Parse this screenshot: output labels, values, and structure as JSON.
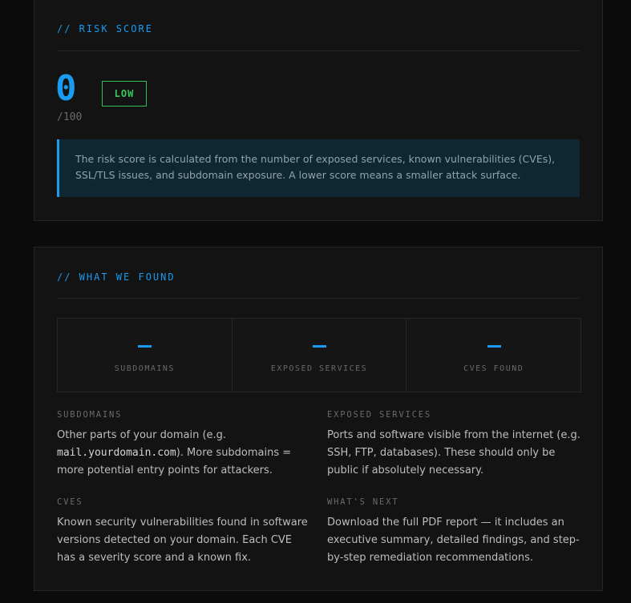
{
  "risk_score": {
    "section_title": "// RISK SCORE",
    "score": "0",
    "max": "/100",
    "level": "LOW",
    "note": "The risk score is calculated from the number of exposed services, known vulnerabilities (CVEs), SSL/TLS issues, and subdomain exposure. A lower score means a smaller attack surface."
  },
  "findings": {
    "section_title": "// WHAT WE FOUND",
    "stats": [
      {
        "value": "",
        "label": "SUBDOMAINS"
      },
      {
        "value": "",
        "label": "EXPOSED SERVICES"
      },
      {
        "value": "",
        "label": "CVES FOUND"
      }
    ],
    "info": {
      "subdomains": {
        "heading": "SUBDOMAINS",
        "text_before": "Other parts of your domain (e.g. ",
        "code": "mail.yourdomain.com",
        "text_after": "). More subdomains = more potential entry points for attackers."
      },
      "exposed_services": {
        "heading": "EXPOSED SERVICES",
        "text": "Ports and software visible from the internet (e.g. SSH, FTP, databases). These should only be public if absolutely necessary."
      },
      "cves": {
        "heading": "CVES",
        "text": "Known security vulnerabilities found in software versions detected on your domain. Each CVE has a severity score and a known fix."
      },
      "whats_next": {
        "heading": "WHAT'S NEXT",
        "text": "Download the full PDF report — it includes an executive summary, detailed findings, and step-by-step remediation recommendations."
      }
    }
  },
  "colors": {
    "accent": "#1a9bf0",
    "low_badge": "#36c95d",
    "card_bg": "#131313",
    "page_bg": "#0b0b0b"
  }
}
